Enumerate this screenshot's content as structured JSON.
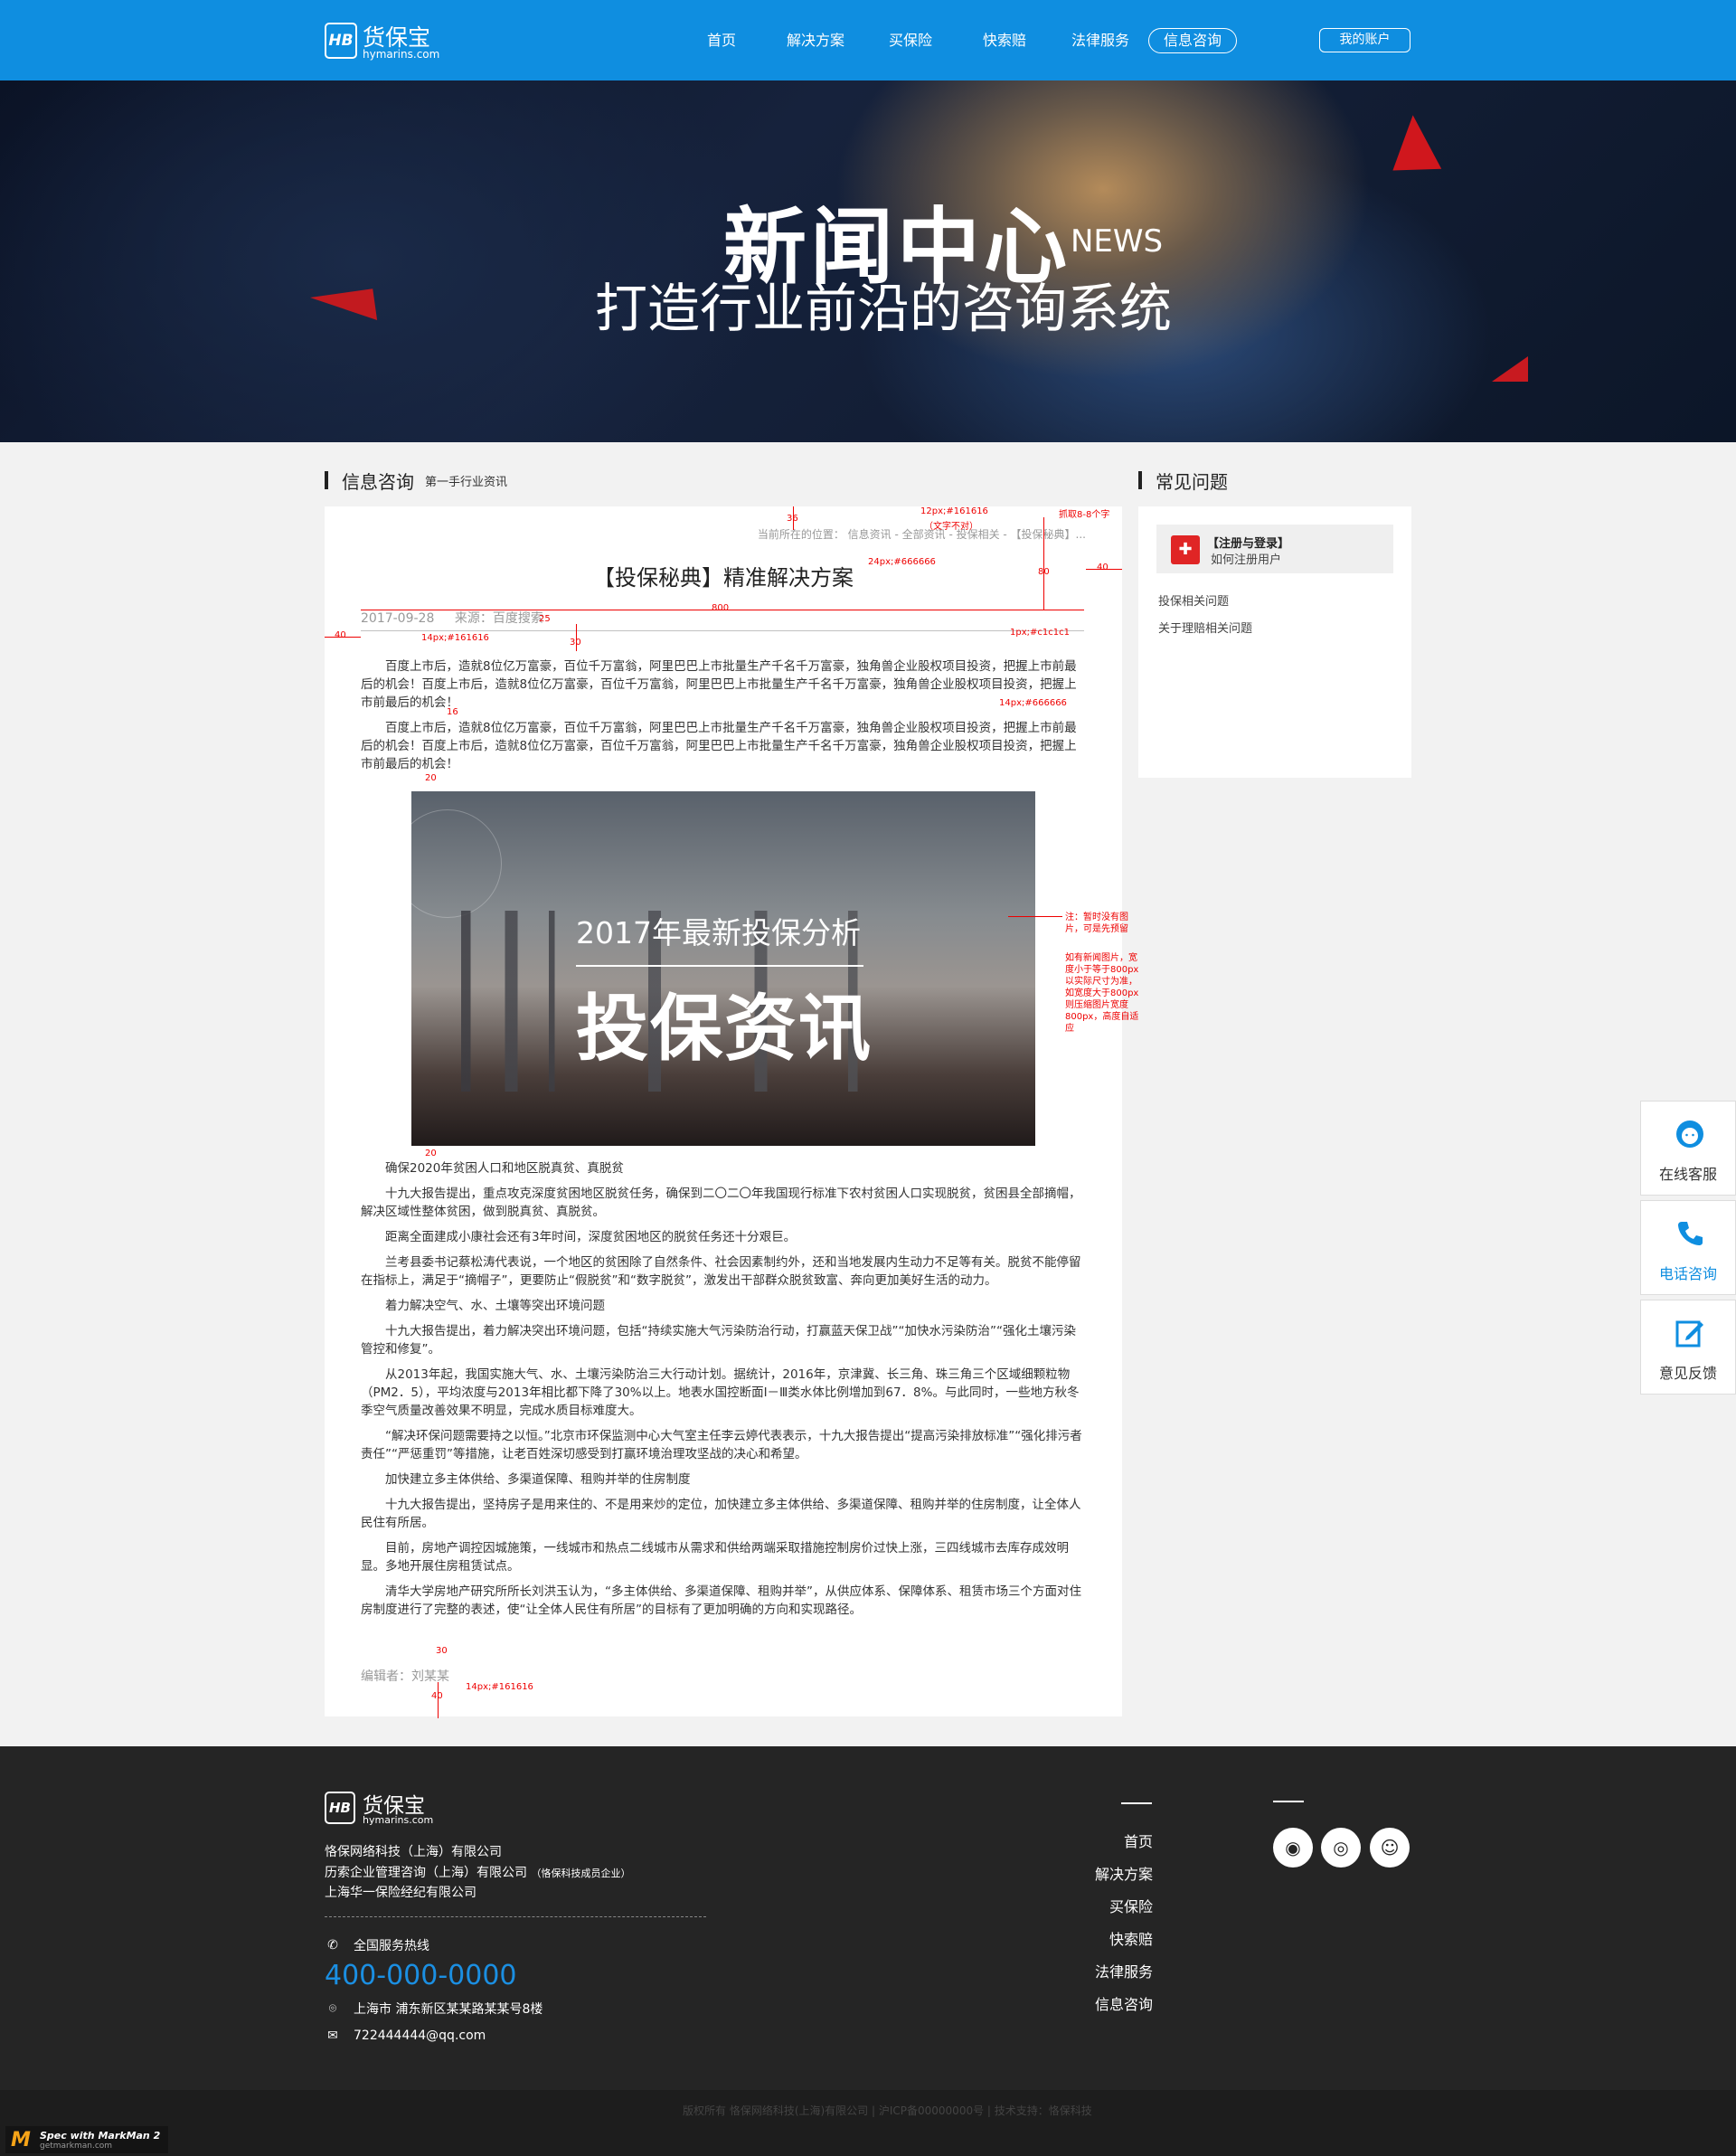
{
  "header": {
    "logo_mark": "HB",
    "logo_name": "货保宝",
    "logo_url": "hymarins.com",
    "nav": [
      "首页",
      "解决方案",
      "买保险",
      "快索赔",
      "法律服务",
      "信息咨询"
    ],
    "active_nav": "信息咨询",
    "account": "我的账户",
    "brand_color": "#0f8ee0"
  },
  "banner": {
    "title": "新闻中心",
    "title_en": "NEWS",
    "subtitle": "打造行业前沿的咨询系统"
  },
  "main": {
    "section_title": "信息咨询",
    "section_sub": "第一手行业资讯",
    "breadcrumb": "当前所在的位置：  信息资讯  -  全部资讯  -  投保相关  -  【投保秘典】...",
    "article": {
      "title": "【投保秘典】精准解决方案",
      "date": "2017-09-28",
      "source": "来源：百度搜索",
      "para1": "百度上市后，造就8位亿万富豪，百位千万富翁，阿里巴巴上市批量生产千名千万富豪，独角兽企业股权项目投资，把握上市前最后的机会！百度上市后，造就8位亿万富豪，百位千万富翁，阿里巴巴上市批量生产千名千万富豪，独角兽企业股权项目投资，把握上市前最后的机会！",
      "para2": "百度上市后，造就8位亿万富豪，百位千万富翁，阿里巴巴上市批量生产千名千万富豪，独角兽企业股权项目投资，把握上市前最后的机会！百度上市后，造就8位亿万富豪，百位千万富翁，阿里巴巴上市批量生产千名千万富豪，独角兽企业股权项目投资，把握上市前最后的机会！",
      "image_year": "2017年最新投保分析",
      "image_big": "投保资讯",
      "paras": [
        "确保2020年贫困人口和地区脱真贫、真脱贫",
        "十九大报告提出，重点攻克深度贫困地区脱贫任务，确保到二〇二〇年我国现行标准下农村贫困人口实现脱贫，贫困县全部摘帽，解决区域性整体贫困，做到脱真贫、真脱贫。",
        "距离全面建成小康社会还有3年时间，深度贫困地区的脱贫任务还十分艰巨。",
        "兰考县委书记蔡松涛代表说，一个地区的贫困除了自然条件、社会因素制约外，还和当地发展内生动力不足等有关。脱贫不能停留在指标上，满足于“摘帽子”，更要防止“假脱贫”和“数字脱贫”，激发出干部群众脱贫致富、奔向更加美好生活的动力。",
        "着力解决空气、水、土壤等突出环境问题",
        "十九大报告提出，着力解决突出环境问题，包括“持续实施大气污染防治行动，打赢蓝天保卫战”“加快水污染防治”“强化土壤污染管控和修复”。",
        "从2013年起，我国实施大气、水、土壤污染防治三大行动计划。据统计，2016年，京津冀、长三角、珠三角三个区域细颗粒物（PM2．5），平均浓度与2013年相比都下降了30%以上。地表水国控断面Ⅰ－Ⅲ类水体比例增加到67．8%。与此同时，一些地方秋冬季空气质量改善效果不明显，完成水质目标难度大。",
        "“解决环保问题需要持之以恒。”北京市环保监测中心大气室主任李云婷代表表示，十九大报告提出“提高污染排放标准”“强化排污者责任”“严惩重罚”等措施，让老百姓深切感受到打赢环境治理攻坚战的决心和希望。",
        "加快建立多主体供给、多渠道保障、租购并举的住房制度",
        "十九大报告提出，坚持房子是用来住的、不是用来炒的定位，加快建立多主体供给、多渠道保障、租购并举的住房制度，让全体人民住有所居。",
        "目前，房地产调控因城施策，一线城市和热点二线城市从需求和供给两端采取措施控制房价过快上涨，三四线城市去库存成效明显。多地开展住房租赁试点。",
        "清华大学房地产研究所所长刘洪玉认为，“多主体供给、多渠道保障、租购并举”，从供应体系、保障体系、租赁市场三个方面对住房制度进行了完整的表述，使“让全体人民住有所居”的目标有了更加明确的方向和实现路径。"
      ],
      "editor": "编辑者：刘某某"
    }
  },
  "sidebar": {
    "title": "常见问题",
    "top_title": "【注册与登录】",
    "top_sub": "如何注册用户",
    "links": [
      "投保相关问题",
      "关于理赔相关问题"
    ]
  },
  "float": {
    "service": "在线客服",
    "phone": "电话咨询",
    "feedback": "意见反馈"
  },
  "annotations": {
    "a36": "36",
    "a12px": "12px;#161616",
    "a12note": "（文字不对）",
    "a_grab": "抓取8-8个字",
    "a24px": "24px;#666666",
    "a80": "80",
    "a40r": "40",
    "a800": "800",
    "a40l": "40",
    "a28": "2017-09-28",
    "a25": "25",
    "a14px1": "14px;#161616",
    "a30a": "30",
    "a1px": "1px;#c1c1c1",
    "a16": "16",
    "a14px666": "14px;#666666",
    "a20a": "20",
    "a_note1": "注：暂时没有图片，可是先预留",
    "a_note2": "如有新闻图片，宽度小于等于800px以实际尺寸为准，如宽度大于800px则压缩图片宽度800px，高度自适应",
    "a20b": "20",
    "a30b": "30",
    "a14px2": "14px;#161616",
    "a40b": "40"
  },
  "footer": {
    "logo_mark": "HB",
    "logo_name": "货保宝",
    "logo_url": "hymarins.com",
    "company1": "恪保网络科技（上海）有限公司",
    "company2": "历索企业管理咨询（上海）有限公司",
    "company2_note": "（恪保科技成员企业）",
    "company3": "上海华一保险经纪有限公司",
    "hotline_label": "全国服务热线",
    "hotline": "400-000-0000",
    "address": "上海市  浦东新区某某路某某号8楼",
    "email": "722444444@qq.com",
    "nav": [
      "首页",
      "解决方案",
      "买保险",
      "快索赔",
      "法律服务",
      "信息咨询"
    ],
    "copyright": "版权所有  恪保网络科技(上海)有限公司  |  沪ICP备00000000号  |  技术支持：恪保科技"
  },
  "watermark": {
    "title": "Spec with MarkMan 2",
    "url": "getmarkman.com"
  }
}
